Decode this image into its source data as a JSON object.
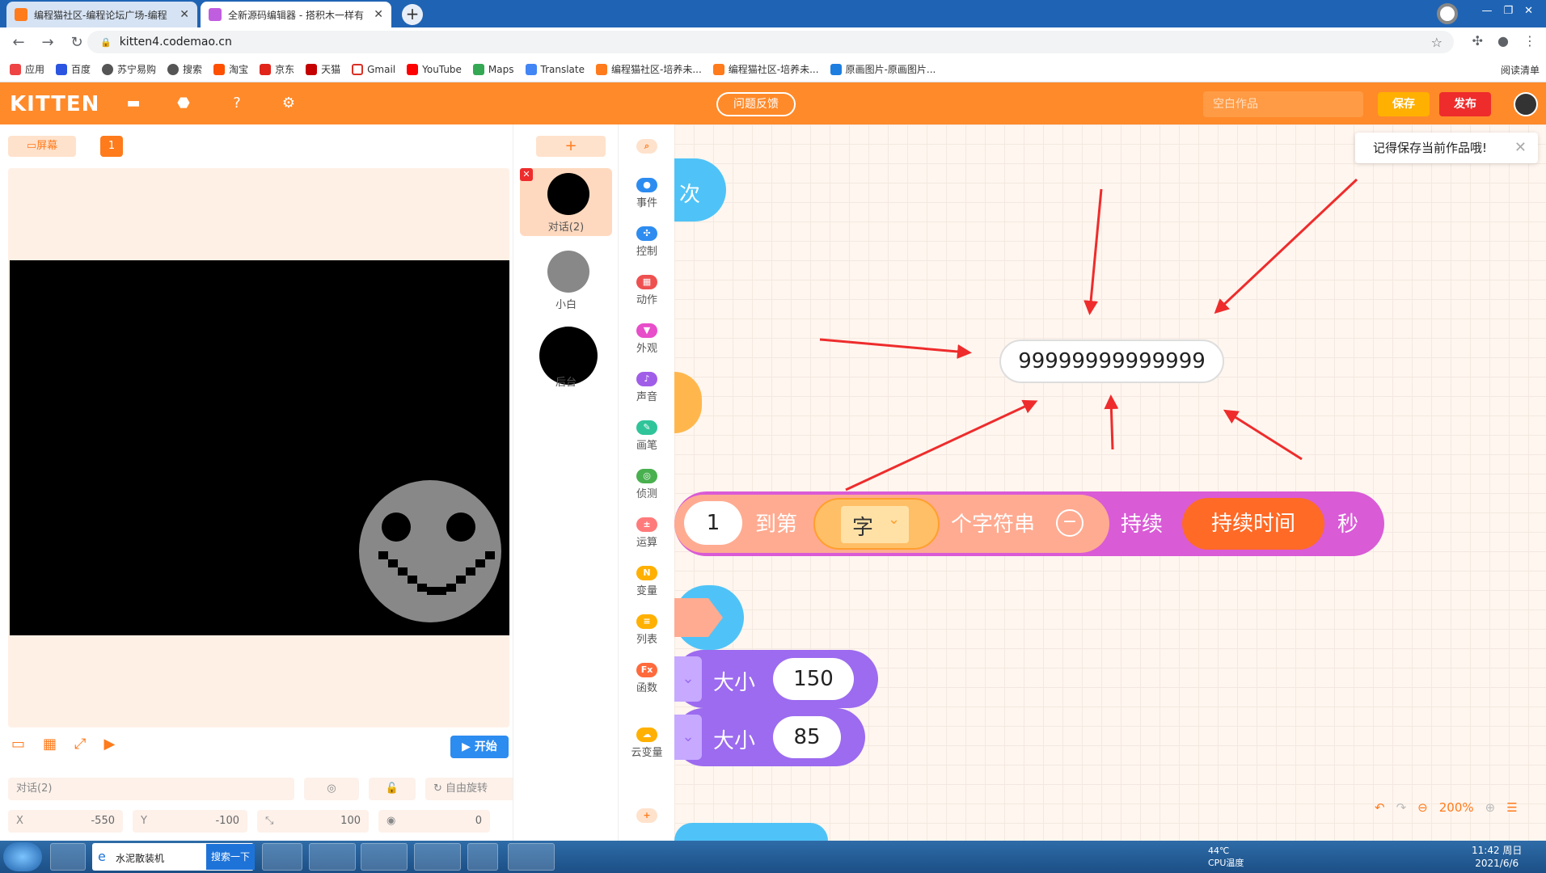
{
  "browser": {
    "tabs": [
      {
        "title": "编程猫社区-编程论坛广场-编程",
        "active": false
      },
      {
        "title": "全新源码编辑器 - 搭积木一样有",
        "active": true
      }
    ],
    "url": "kitten4.codemao.cn",
    "bookmarks": [
      "应用",
      "百度",
      "苏宁易购",
      "搜索",
      "淘宝",
      "京东",
      "天猫",
      "Gmail",
      "YouTube",
      "Maps",
      "Translate",
      "编程猫社区-培养未...",
      "编程猫社区-培养未...",
      "原画图片-原画图片..."
    ],
    "reading_list": "阅读清单"
  },
  "app": {
    "logo": "KITTEN",
    "feedback": "问题反馈",
    "work_name_placeholder": "空白作品",
    "save": "保存",
    "publish": "发布",
    "tip": "记得保存当前作品哦!"
  },
  "stage": {
    "screen_tab": "屏幕",
    "screen_number": "1",
    "start": "开始",
    "sprite_name": "对话(2)",
    "rotation_mode": "自由旋转",
    "x_label": "X",
    "x_value": "-550",
    "y_label": "Y",
    "y_value": "-100",
    "size_value": "100",
    "direction_value": "0"
  },
  "sprites": [
    {
      "name": "对话(2)",
      "selected": true
    },
    {
      "name": "小白",
      "selected": false
    },
    {
      "name": "后台",
      "selected": false
    }
  ],
  "categories": [
    {
      "label": "事件",
      "color": "#2d8cf0"
    },
    {
      "label": "控制",
      "color": "#2d8cf0"
    },
    {
      "label": "动作",
      "color": "#ee5050"
    },
    {
      "label": "外观",
      "color": "#e84ec9"
    },
    {
      "label": "声音",
      "color": "#a05ee8"
    },
    {
      "label": "画笔",
      "color": "#30c49a"
    },
    {
      "label": "侦测",
      "color": "#49b04f"
    },
    {
      "label": "运算",
      "color": "#ff7b7b"
    },
    {
      "label": "变量",
      "color": "#ffb000"
    },
    {
      "label": "列表",
      "color": "#ffb000"
    },
    {
      "label": "函数",
      "color": "#ff6a3d"
    },
    {
      "label": "云变量",
      "color": "#ffb000"
    }
  ],
  "workspace": {
    "block_times": "次",
    "reporter_value": "99999999999999",
    "say_block": {
      "index": "1",
      "to_label": "到第",
      "dropdown": "字",
      "suffix": "个字符串",
      "duration_label": "持续",
      "duration_var": "持续时间",
      "seconds": "秒"
    },
    "size_label_1": "大小",
    "size_value_1": "150",
    "size_label_2": "大小",
    "size_value_2": "85",
    "zoom": "200%"
  },
  "taskbar": {
    "search_text": "水泥散装机",
    "search_button": "搜索一下",
    "temp": "44℃",
    "cpu": "CPU温度",
    "time": "11:42 周日",
    "date": "2021/6/6"
  }
}
